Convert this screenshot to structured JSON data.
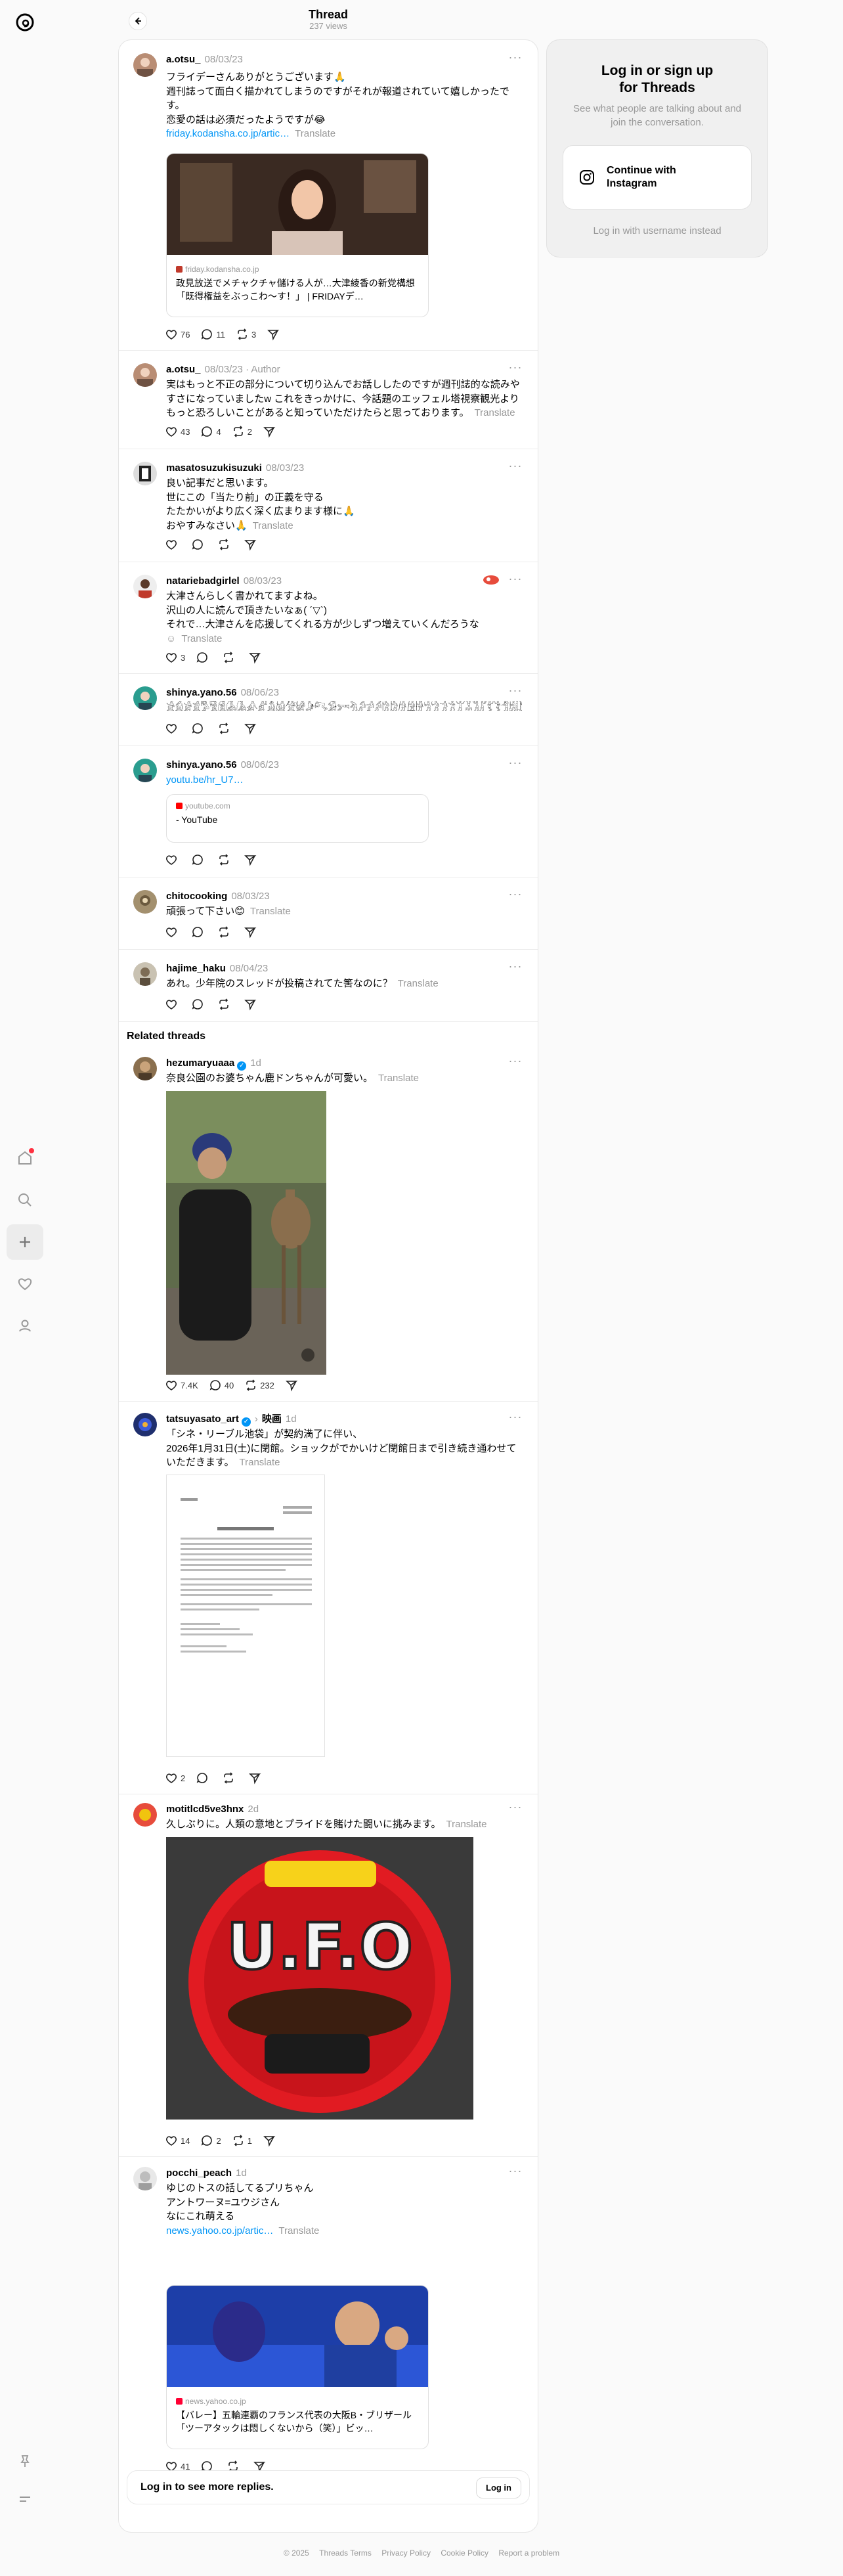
{
  "header": {
    "title": "Thread",
    "views": "237 views"
  },
  "posts": [
    {
      "username": "a.otsu_",
      "date": "08/03/23",
      "text_lines": [
        "フライデーさんありがとうございます🙏",
        "週刊誌って面白く描かれてしまうのですがそれが報道されていて嬉しかったです。",
        "恋愛の話は必須だったようですが😂"
      ],
      "link": "friday.kodansha.co.jp/artic…",
      "translate": "Translate",
      "card_domain": "friday.kodansha.co.jp",
      "card_title": "政見放送でメチャクチャ儲ける人が…大津綾香の新党構想「既得権益をぶっこわ〜す！」 | FRIDAYデ…",
      "likes": "76",
      "replies": "11",
      "reposts": "3"
    },
    {
      "username": "a.otsu_",
      "date": "08/03/23",
      "author": "Author",
      "text": "実はもっと不正の部分について切り込んでお話ししたのですが週刊誌的な読みやすさになっていましたw これをきっかけに、今話題のエッフェル塔視察観光よりもっと恐ろしいことがあると知っていただけたらと思っております。",
      "translate": "Translate",
      "likes": "43",
      "replies": "4",
      "reposts": "2"
    },
    {
      "username": "masatosuzukisuzuki",
      "date": "08/03/23",
      "text_lines": [
        "良い記事だと思います。",
        "世にこの「当たり前」の正義を守る",
        "たたかいがより広く深く広まります様に🙏",
        "おやすみなさい🙏"
      ],
      "translate": "Translate"
    },
    {
      "username": "natariebadgirlel",
      "date": "08/03/23",
      "text_lines": [
        "大津さんらしく書かれてますよね。",
        "沢山の人に読んで頂きたいなぁ( ´▽`)",
        "それで…大津さんを応援してくれる方が少しずつ増えていくんだろうな"
      ],
      "translate": "Translate",
      "likes": "3"
    },
    {
      "username": "shinya.yano.56",
      "date": "08/06/23",
      "text": "𓀀𓀁𓀂𓀃𓀄𓀅𓀆𓀇𓀈𓀉𓀊𓀋𓀌𓀍𓀎𓀏𓀐𓀑𓀒𓀓𓀔𓀕𓀖𓀗𓀘𓀙𓀚𓀛𓀜𓀝𓀞𓀟𓀠𓀡𓀢𓀣𓀤𓀥𓀦𓀧𓀨𓀩𓀪𓀫𓀬𓀭"
    },
    {
      "username": "shinya.yano.56",
      "date": "08/06/23",
      "link": "youtu.be/hr_U7…",
      "card_domain": "youtube.com",
      "card_title": "- YouTube"
    },
    {
      "username": "chitocooking",
      "date": "08/03/23",
      "text": "頑張って下さい😊",
      "translate": "Translate"
    },
    {
      "username": "hajime_haku",
      "date": "08/04/23",
      "text": "あれ。少年院のスレッドが投稿されてた筈なのに？",
      "translate": "Translate"
    }
  ],
  "related": {
    "title": "Related threads",
    "items": [
      {
        "username": "hezumaryuaaa",
        "date": "1d",
        "text": "奈良公園のお婆ちゃん鹿ドンちゃんが可愛い。",
        "translate": "Translate",
        "likes": "7.4K",
        "replies": "40",
        "reposts": "232"
      },
      {
        "username": "tatsuyasato_art",
        "tag": "映画",
        "date": "1d",
        "text_lines": [
          "「シネ・リーブル池袋」が契約満了に伴い、",
          "2026年1月31日(土)に閉館。ショックがでかいけど閉館日まで引き続き通わせていただきます。"
        ],
        "translate": "Translate",
        "likes": "2"
      },
      {
        "username": "motitlcd5ve3hnx",
        "date": "2d",
        "text": "久しぶりに。人類の意地とプライドを賭けた闘いに挑みます。",
        "translate": "Translate",
        "likes": "14",
        "replies": "2",
        "reposts": "1",
        "image_text": "U.F.O"
      },
      {
        "username": "pocchi_peach",
        "date": "1d",
        "text_lines": [
          "ゆじのトスの話してるプリちゃん",
          "アントワーヌ=ユウジさん",
          "なにこれ萌える"
        ],
        "link": "news.yahoo.co.jp/artic…",
        "translate": "Translate",
        "card_domain": "news.yahoo.co.jp",
        "card_title": "【バレー】五輪連覇のフランス代表の大阪B・ブリザール「ツーアタックは悶しくないから（笑）」ビッ…",
        "likes": "41"
      }
    ]
  },
  "login_footer": {
    "text": "Log in to see more replies.",
    "button": "Log in"
  },
  "sidebar": {
    "title_line1": "Log in or sign up",
    "title_line2": "for Threads",
    "subtitle": "See what people are talking about and join the conversation.",
    "instagram_button": "Continue with Instagram",
    "alt_login": "Log in with username instead"
  },
  "footer": {
    "copyright": "© 2025",
    "links": [
      "Threads Terms",
      "Privacy Policy",
      "Cookie Policy",
      "Report a problem"
    ]
  },
  "colors": {
    "link": "#0095f6",
    "muted": "#999999",
    "verified": "#0095f6",
    "notification": "#ff3040"
  }
}
